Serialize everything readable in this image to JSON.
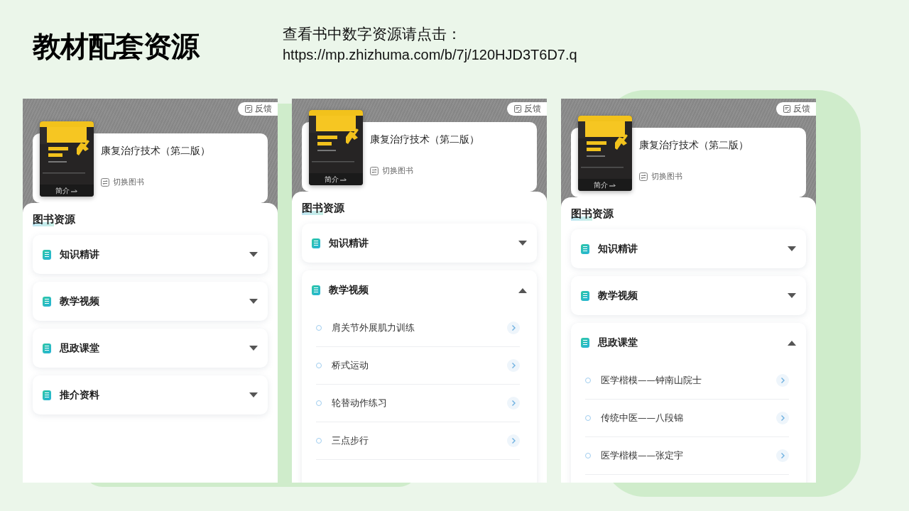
{
  "slide": {
    "title": "教材配套资源",
    "note": "查看书中数字资源请点击：",
    "link": "https://mp.zhizhuma.com/b/7j/120HJD3T6D7.q"
  },
  "phones": [
    {
      "feedback": "反馈",
      "book": {
        "title": "康复治疗技术（第二版）",
        "intro": "简介",
        "switch": "切换图书"
      },
      "section_title": "图书资源",
      "groups": [
        {
          "label": "知识精讲",
          "expanded": false
        },
        {
          "label": "教学视频",
          "expanded": false
        },
        {
          "label": "思政课堂",
          "expanded": false
        },
        {
          "label": "推介资料",
          "expanded": false
        }
      ]
    },
    {
      "feedback": "反馈",
      "book": {
        "title": "康复治疗技术（第二版）",
        "intro": "简介",
        "switch": "切换图书"
      },
      "section_title": "图书资源",
      "groups": [
        {
          "label": "知识精讲",
          "expanded": false
        },
        {
          "label": "教学视频",
          "expanded": true,
          "items": [
            "肩关节外展肌力训练",
            "桥式运动",
            "轮替动作练习",
            "三点步行"
          ]
        }
      ]
    },
    {
      "feedback": "反馈",
      "book": {
        "title": "康复治疗技术（第二版）",
        "intro": "简介",
        "switch": "切换图书"
      },
      "section_title": "图书资源",
      "groups": [
        {
          "label": "知识精讲",
          "expanded": false
        },
        {
          "label": "教学视频",
          "expanded": false
        },
        {
          "label": "思政课堂",
          "expanded": true,
          "items": [
            "医学楷模——钟南山院士",
            "传统中医——八段锦",
            "医学楷模——张定宇"
          ]
        }
      ]
    }
  ]
}
